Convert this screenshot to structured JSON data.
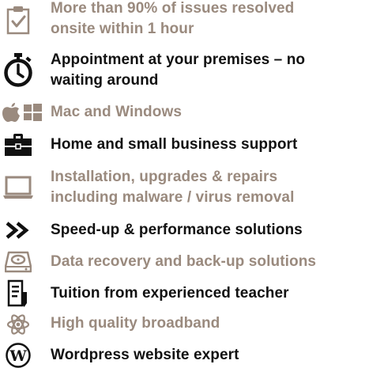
{
  "colors": {
    "muted": "#9a8a7e",
    "dark": "#111111"
  },
  "items": [
    {
      "icon": "checklist-icon",
      "lines": [
        "More than 90% of issues resolved",
        "onsite within 1 hour"
      ],
      "tone": "muted"
    },
    {
      "icon": "stopwatch-icon",
      "lines": [
        "Appointment at your premises – no",
        "waiting around"
      ],
      "tone": "dark"
    },
    {
      "icon": "apple-windows-icon",
      "lines": [
        "Mac and Windows"
      ],
      "tone": "muted"
    },
    {
      "icon": "briefcase-icon",
      "lines": [
        "Home and small business support"
      ],
      "tone": "dark"
    },
    {
      "icon": "laptop-icon",
      "lines": [
        "Installation, upgrades & repairs",
        "including malware / virus removal"
      ],
      "tone": "muted"
    },
    {
      "icon": "fast-forward-icon",
      "lines": [
        "Speed-up & performance solutions"
      ],
      "tone": "dark"
    },
    {
      "icon": "hard-drive-icon",
      "lines": [
        "Data recovery and back-up solutions"
      ],
      "tone": "muted"
    },
    {
      "icon": "document-pen-icon",
      "lines": [
        "Tuition from experienced teacher"
      ],
      "tone": "dark"
    },
    {
      "icon": "atom-icon",
      "lines": [
        "High quality broadband"
      ],
      "tone": "muted"
    },
    {
      "icon": "wordpress-icon",
      "lines": [
        "Wordpress website expert"
      ],
      "tone": "dark"
    }
  ]
}
